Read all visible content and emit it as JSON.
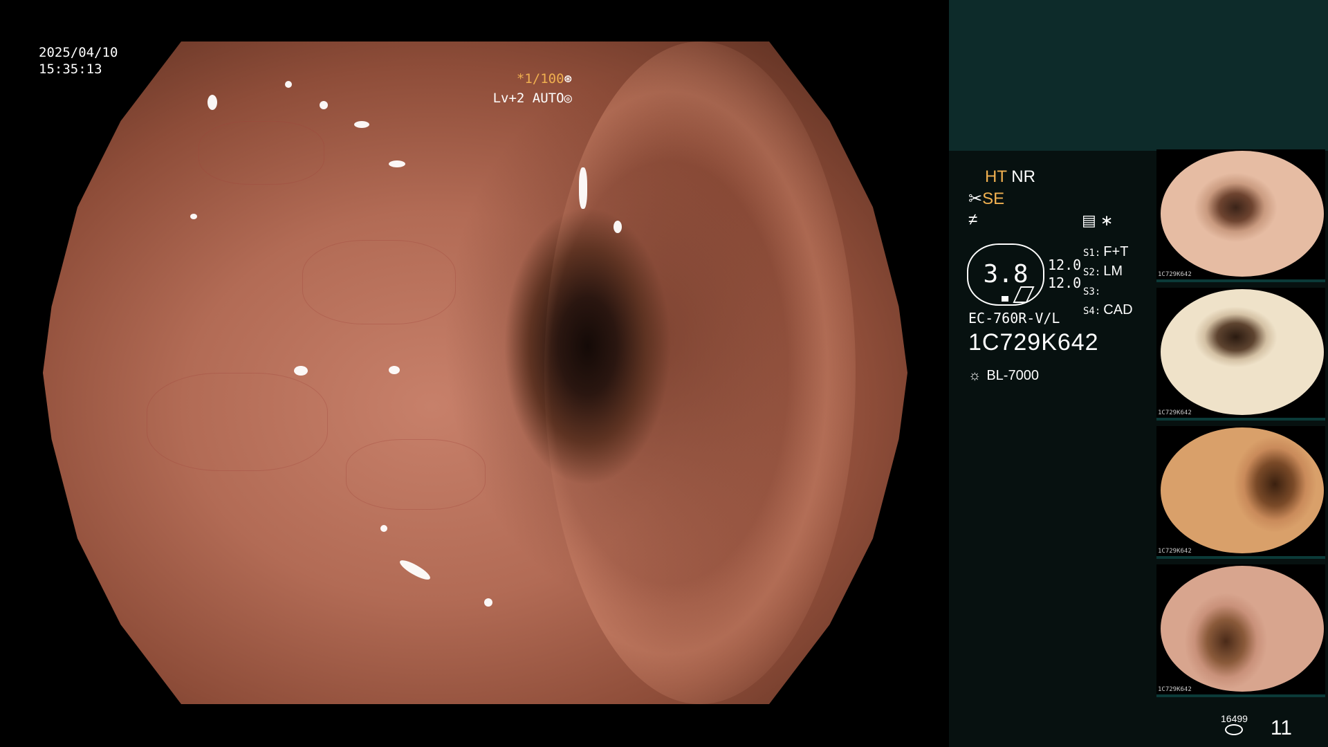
{
  "scope": {
    "date": "2025/04/10",
    "time": "15:35:13",
    "shutter": "*1/100",
    "level": "Lv+2",
    "mode": "AUTO"
  },
  "panel": {
    "ht": "HT",
    "nr": "NR",
    "se": "SE",
    "zoom": "3.8",
    "gauge_values": [
      "12.0",
      "12.0"
    ],
    "settings": [
      {
        "key": "S1:",
        "value": "F+T"
      },
      {
        "key": "S2:",
        "value": "LM"
      },
      {
        "key": "S3:",
        "value": ""
      },
      {
        "key": "S4:",
        "value": "CAD"
      }
    ],
    "model": "EC-760R-V/L",
    "serial": "1C729K642",
    "light_source": "BL-7000",
    "storage": "16499",
    "image_count": "11",
    "thumb_label": "1C729K642"
  },
  "colors": {
    "accent": "#f0b050",
    "panel_header": "#0d2b2a",
    "panel_bg": "#071110"
  },
  "icons": [
    "shutter-icon",
    "auto-icon",
    "scissors-icon",
    "filter-icon",
    "settings-list-icon",
    "asterisk-icon",
    "light-source-icon",
    "storage-icon"
  ]
}
